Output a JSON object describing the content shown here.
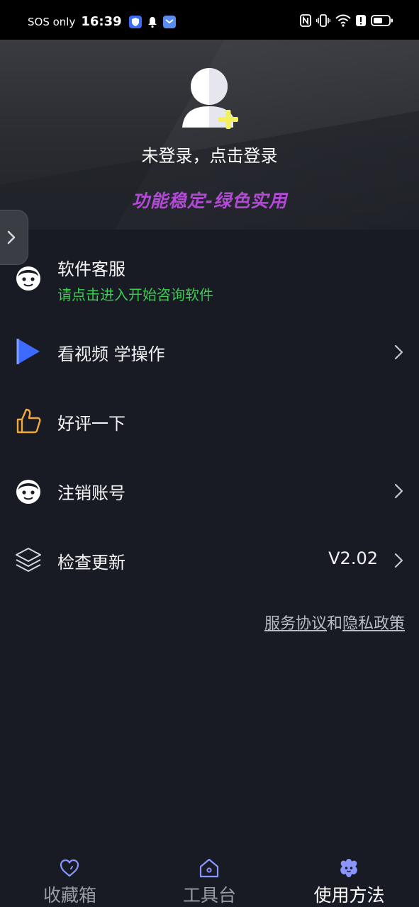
{
  "status_bar": {
    "carrier": "SOS only",
    "time": "16:39"
  },
  "header": {
    "login_prompt": "未登录，点击登录",
    "slogan": "功能稳定-绿色实用"
  },
  "menu": [
    {
      "label": "软件客服",
      "sub": "请点击进入开始咨询软件",
      "icon": "customer-service-icon"
    },
    {
      "label": "看视频 学操作",
      "icon": "play-icon"
    },
    {
      "label": "好评一下",
      "icon": "thumbs-up-icon"
    },
    {
      "label": "注销账号",
      "icon": "customer-service-icon"
    },
    {
      "label": "检查更新",
      "value": "V2.02",
      "icon": "layers-icon"
    }
  ],
  "policy": {
    "service_agreement": "服务协议",
    "and": "和",
    "privacy_policy": "隐私政策"
  },
  "bottom_nav": [
    {
      "label": "收藏箱",
      "icon": "heart-icon"
    },
    {
      "label": "工具台",
      "icon": "home-icon"
    },
    {
      "label": "使用方法",
      "icon": "flower-face-icon",
      "active": true
    }
  ],
  "colors": {
    "background": "#181b23",
    "slogan": "#b24ad6",
    "subtitle_green": "#3ecb53",
    "play_blue": "#3d6bff",
    "thumb_orange": "#f0a93a",
    "accent_yellow": "#f3f05c",
    "nav_active_icon": "#8a95ff"
  }
}
